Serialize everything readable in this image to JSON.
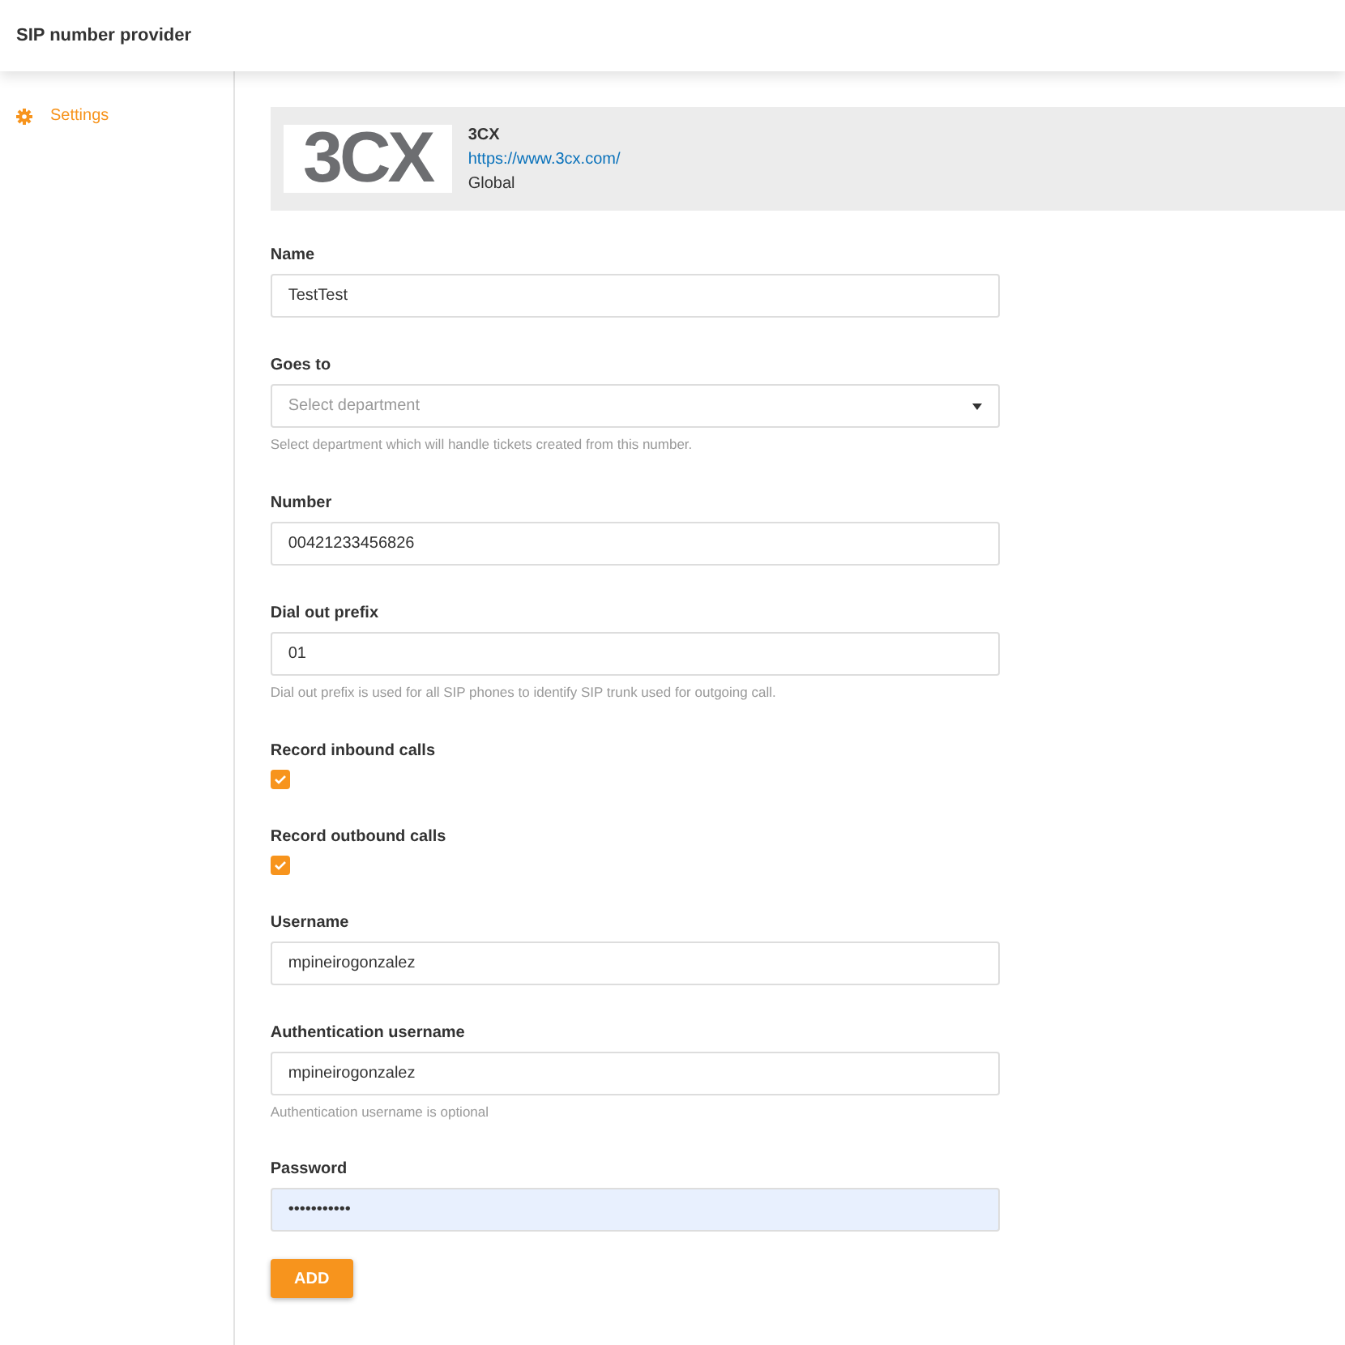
{
  "header": {
    "title": "SIP number provider"
  },
  "sidebar": {
    "items": [
      {
        "label": "Settings",
        "selected": true
      }
    ]
  },
  "provider": {
    "logo": "3CX",
    "name": "3CX",
    "url": "https://www.3cx.com/",
    "region": "Global"
  },
  "fields": [
    {
      "kind": "text",
      "label": "Name",
      "value": "TestTest"
    },
    {
      "kind": "select",
      "label": "Goes to",
      "placeholder": "Select department",
      "help": "Select department which will handle tickets created from this number."
    },
    {
      "kind": "text",
      "label": "Number",
      "value": "00421233456826"
    },
    {
      "kind": "text",
      "label": "Dial out prefix",
      "value": "01",
      "help": "Dial out prefix is used for all SIP phones to identify SIP trunk used for outgoing call."
    },
    {
      "kind": "checkbox",
      "label": "Record inbound calls",
      "checked": true
    },
    {
      "kind": "checkbox",
      "label": "Record outbound calls",
      "checked": true
    },
    {
      "kind": "text",
      "label": "Username",
      "value": "mpineirogonzalez"
    },
    {
      "kind": "text",
      "label": "Authentication username",
      "value": "mpineirogonzalez",
      "help": "Authentication username is optional"
    },
    {
      "kind": "password",
      "label": "Password",
      "value": "•••••••••••"
    }
  ],
  "submit": {
    "label": "ADD"
  }
}
